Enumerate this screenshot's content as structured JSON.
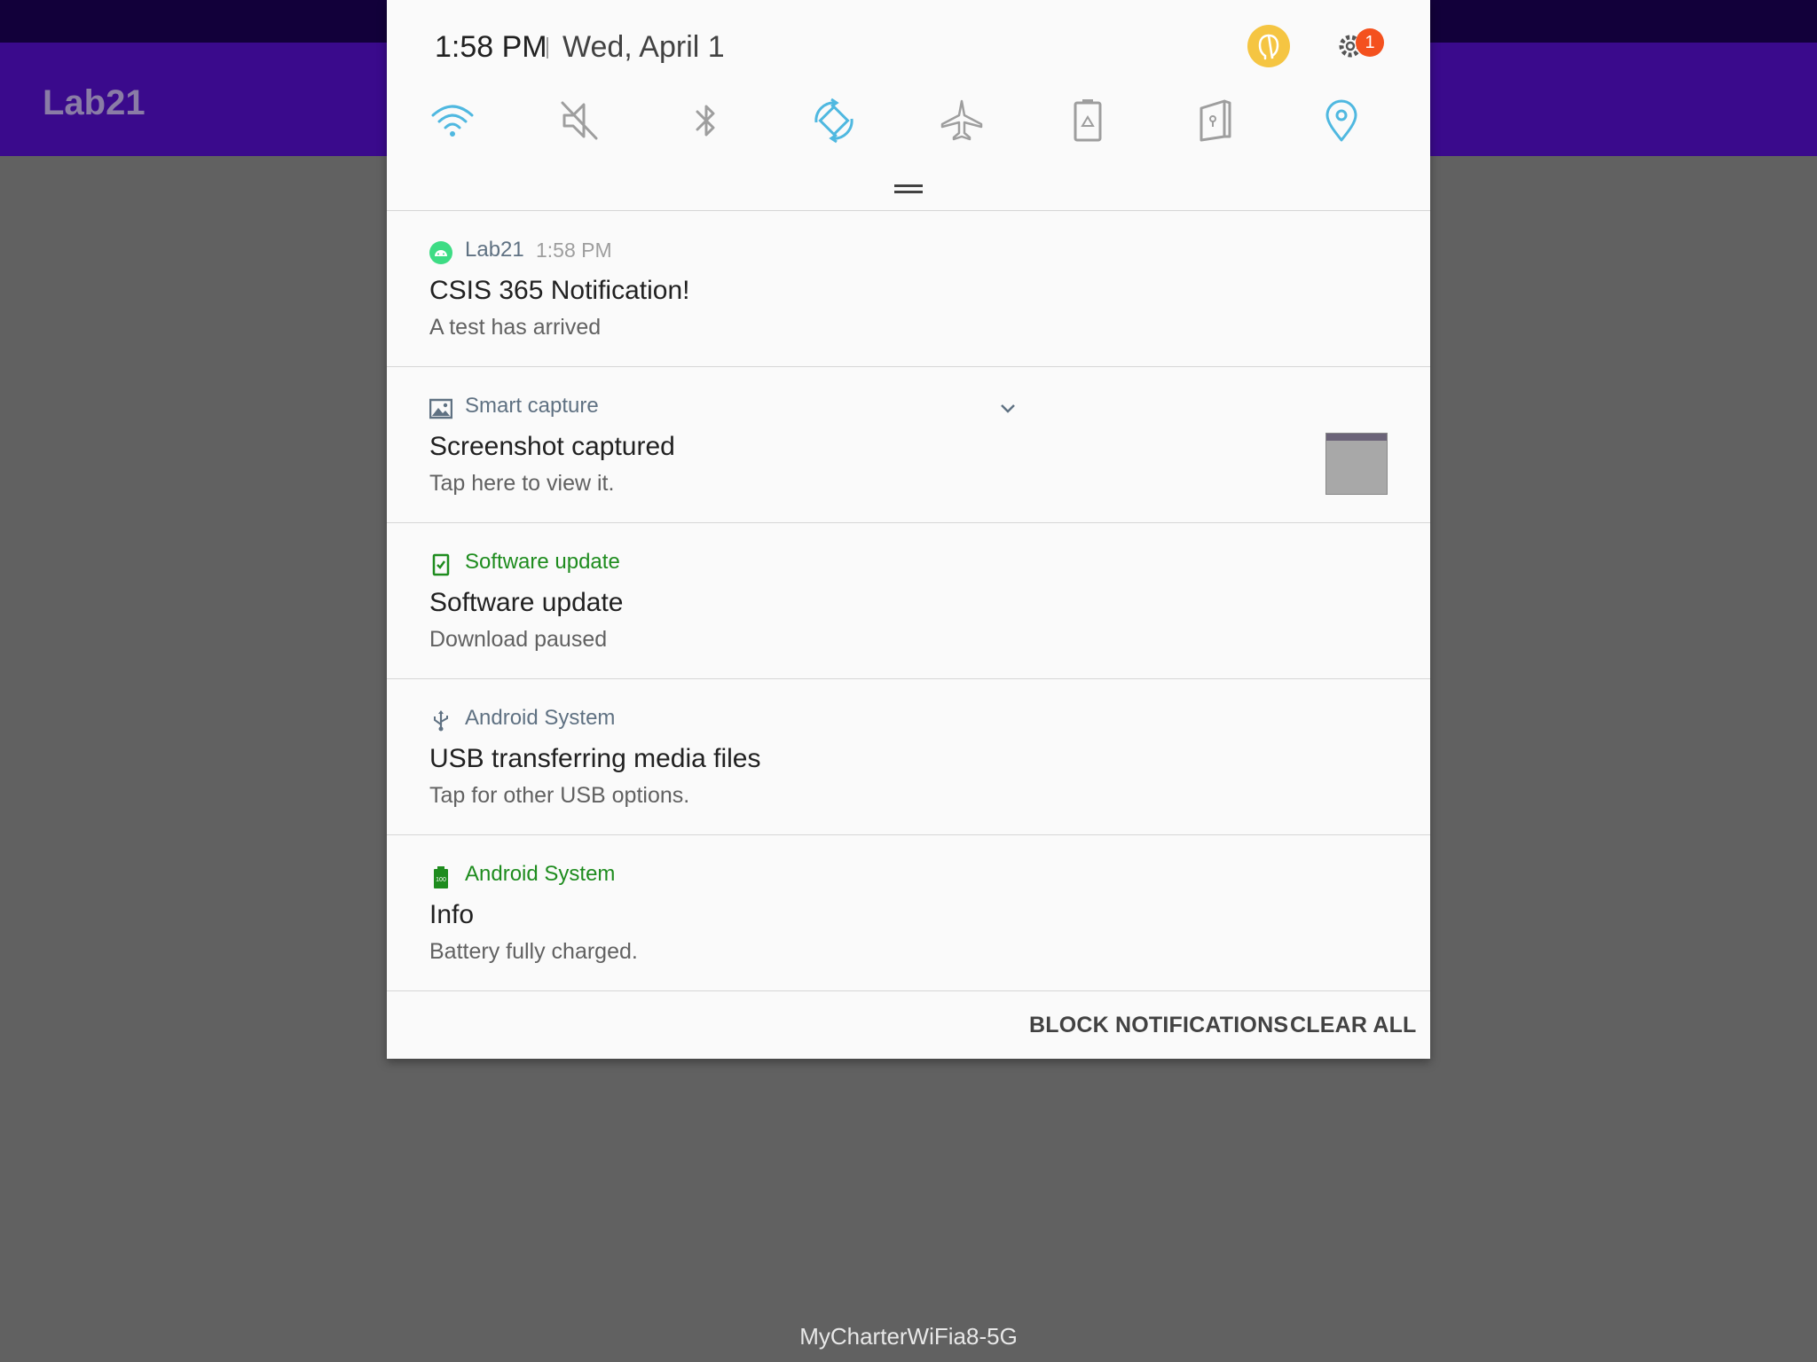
{
  "app": {
    "title": "Lab21"
  },
  "header": {
    "time": "1:58 PM",
    "date": "Wed, April 1",
    "settings_badge": "1"
  },
  "quick_settings": [
    {
      "name": "wifi-icon",
      "active": true
    },
    {
      "name": "mute-icon",
      "active": false
    },
    {
      "name": "bluetooth-icon",
      "active": false
    },
    {
      "name": "auto-rotate-icon",
      "active": true
    },
    {
      "name": "airplane-mode-icon",
      "active": false
    },
    {
      "name": "power-saving-icon",
      "active": false
    },
    {
      "name": "secure-folder-icon",
      "active": false
    },
    {
      "name": "location-icon",
      "active": true
    }
  ],
  "notifications": [
    {
      "app": "Lab21",
      "time": "1:58 PM",
      "title": "CSIS 365 Notification!",
      "text": "A test has arrived",
      "icon": "android-icon"
    },
    {
      "app": "Smart capture",
      "title": "Screenshot captured",
      "text": "Tap here to view it.",
      "icon": "image-icon"
    },
    {
      "app": "Software update",
      "title": "Software update",
      "text": "Download paused",
      "icon": "software-update-icon"
    },
    {
      "app": "Android System",
      "title": "USB transferring media files",
      "text": "Tap for other USB options.",
      "icon": "usb-icon"
    },
    {
      "app": "Android System",
      "title": "Info",
      "text": "Battery fully charged.",
      "icon": "battery-full-icon",
      "icon_label": "100"
    }
  ],
  "actions": {
    "block": "BLOCK NOTIFICATIONS",
    "clear": "CLEAR ALL"
  },
  "footer": {
    "network": "MyCharterWiFia8-5G"
  },
  "colors": {
    "accent": "#4fb8e0",
    "inactive": "#9e9e9e",
    "app_bar": "#3a0a8c",
    "green": "#1e8c1e"
  }
}
